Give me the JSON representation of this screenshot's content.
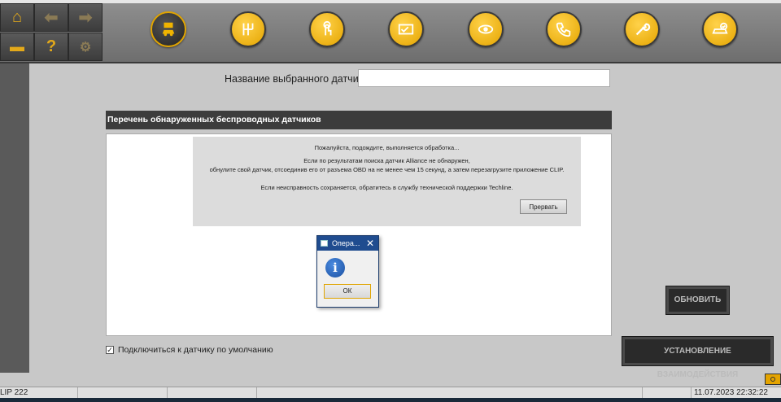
{
  "toolbar": {
    "nav": [
      {
        "name": "home-icon",
        "glyph": "⌂"
      },
      {
        "name": "back-arrow-icon",
        "glyph": "⬅"
      },
      {
        "name": "forward-arrow-icon",
        "glyph": "➡"
      },
      {
        "name": "printer-icon",
        "glyph": "▬"
      },
      {
        "name": "help-icon",
        "glyph": "?"
      },
      {
        "name": "vehicle-settings-icon",
        "glyph": "⚙"
      }
    ],
    "circles": [
      "diagnostic-message-icon",
      "gearbox-icon",
      "touch-icon",
      "card-icon",
      "car-sensor-icon",
      "phone-support-icon",
      "wrench-icon",
      "vehicle-check-icon"
    ]
  },
  "main": {
    "sensor_label": "Название выбранного датчика",
    "list_header": "Перечень обнаруженных беспроводных датчиков",
    "message": {
      "line1": "Пожалуйста, подождите, выполняется обработка...",
      "line2": "Если по результатам поиска датчик Alliance не обнаружен,",
      "line3": "обнулите свой датчик, отсоединив его от разъема OBD на не менее чем 15 секунд, а затем перезагрузите приложение CLIP.",
      "line4": "Если неисправность сохраняется, обратитесь в службу технической поддержки Techline.",
      "abort": "Прервать"
    },
    "checkbox_label": "Подключиться к датчику по умолчанию",
    "checkbox_checked": true,
    "refresh": "ОБНОВИТЬ",
    "interact": "УСТАНОВЛЕНИЕ ВЗАИМОДЕЙСТВИЯ"
  },
  "dialog": {
    "title": "Опера...",
    "close": "✕",
    "ok": "ОК"
  },
  "status": {
    "app": "LIP 222",
    "datetime": "11.07.2023 22:32:22"
  },
  "colors": {
    "accent": "#e4a400",
    "dark": "#3c3c3c",
    "title_blue": "#1f4c8f"
  }
}
